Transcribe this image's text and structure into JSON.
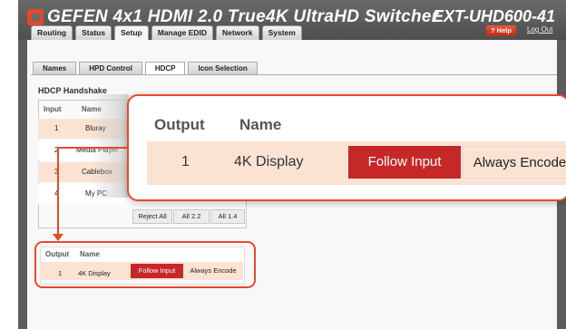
{
  "header": {
    "brand": "GEFEN 4x1 HDMI 2.0 True4K UltraHD Switcher",
    "model": "EXT-UHD600-41",
    "help_label": "? Help",
    "logout_label": "Log Out"
  },
  "tabs": [
    "Routing",
    "Status",
    "Setup",
    "Manage EDID",
    "Network",
    "System"
  ],
  "active_tab": "Setup",
  "subtabs": [
    "Names",
    "HPD Control",
    "HDCP",
    "Icon Selection"
  ],
  "active_subtab": "HDCP",
  "hdcp_handshake": {
    "title": "HDCP Handshake",
    "columns": [
      "Input",
      "Name"
    ],
    "rows": [
      {
        "input": "1",
        "name": "Bluray"
      },
      {
        "input": "2",
        "name": "Media Player"
      },
      {
        "input": "3",
        "name": "Cablebox"
      },
      {
        "input": "4",
        "name": "My PC"
      }
    ],
    "buttons": [
      "Reject All",
      "All 2.2",
      "All 1.4"
    ]
  },
  "output": {
    "columns": [
      "Output",
      "Name"
    ],
    "row": {
      "output": "1",
      "name": "4K Display"
    },
    "follow_label": "Follow Input",
    "always_label": "Always Encode"
  },
  "colors": {
    "accent": "#c62828",
    "highlight": "#e8492c",
    "row_tint": "#fbe3d3"
  }
}
